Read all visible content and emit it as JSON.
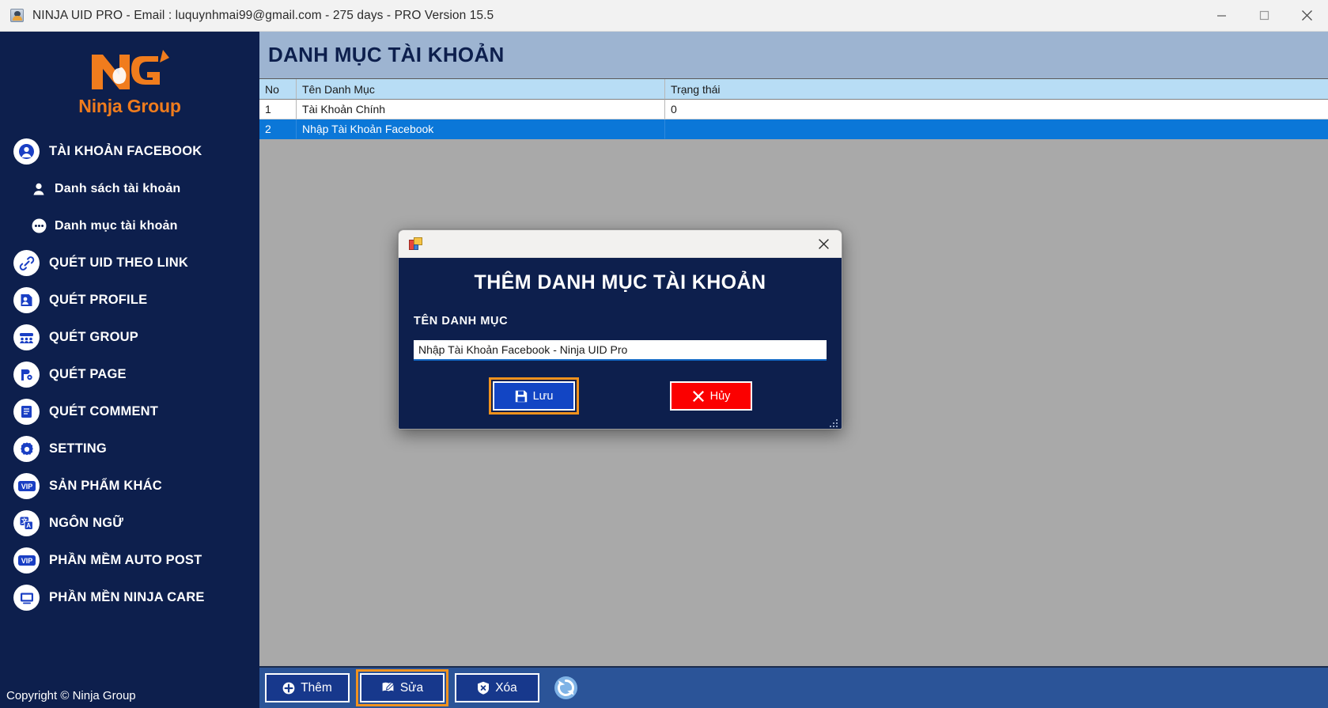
{
  "window": {
    "title": "NINJA UID PRO - Email : luquynhmai99@gmail.com - 275 days -  PRO Version 15.5",
    "app_icon": "ninja-app-icon",
    "controls": {
      "minimize": "minimize-icon",
      "maximize": "maximize-icon",
      "close": "close-icon"
    }
  },
  "sidebar": {
    "logo": {
      "mark": "ng-logo-icon",
      "text": "Ninja Group"
    },
    "items": [
      {
        "label": "TÀI KHOẢN FACEBOOK",
        "icon": "user-circle-icon",
        "sub": false
      },
      {
        "label": "Danh sách tài khoản",
        "icon": "person-icon",
        "sub": true
      },
      {
        "label": "Danh mục tài khoản",
        "icon": "dots-icon",
        "sub": true
      },
      {
        "label": "QUÉT UID THEO LINK",
        "icon": "link-icon",
        "sub": false
      },
      {
        "label": "QUÉT PROFILE",
        "icon": "profile-card-icon",
        "sub": false
      },
      {
        "label": "QUÉT GROUP",
        "icon": "group-icon",
        "sub": false
      },
      {
        "label": "QUÉT PAGE",
        "icon": "page-flag-icon",
        "sub": false
      },
      {
        "label": "QUÉT COMMENT",
        "icon": "document-icon",
        "sub": false
      },
      {
        "label": "SETTING",
        "icon": "gear-icon",
        "sub": false
      },
      {
        "label": "SẢN PHẨM KHÁC",
        "icon": "vip-icon",
        "sub": false
      },
      {
        "label": "NGÔN NGỮ",
        "icon": "translate-icon",
        "sub": false
      },
      {
        "label": "PHẦN MỀM AUTO POST",
        "icon": "vip-icon",
        "sub": false
      },
      {
        "label": "PHẦN MỀN NINJA CARE",
        "icon": "monitor-icon",
        "sub": false
      }
    ],
    "copyright": "Copyright © Ninja Group"
  },
  "main": {
    "page_title": "DANH MỤC TÀI KHOẢN",
    "table": {
      "columns": [
        "No",
        "Tên Danh Mục",
        "Trạng thái"
      ],
      "rows": [
        {
          "no": "1",
          "name": "Tài Khoản Chính",
          "status": "0",
          "selected": false
        },
        {
          "no": "2",
          "name": "Nhập Tài Khoản Facebook",
          "status": "",
          "selected": true
        }
      ]
    }
  },
  "toolbar": {
    "add_label": "Thêm",
    "edit_label": "Sửa",
    "delete_label": "Xóa",
    "add_icon": "plus-circle-icon",
    "edit_icon": "edit-pencil-icon",
    "delete_icon": "shield-delete-icon",
    "refresh_icon": "refresh-icon"
  },
  "modal": {
    "app_icon": "winform-icon",
    "close_icon": "close-icon",
    "title": "THÊM DANH MỤC TÀI KHOẢN",
    "field_label": "TÊN DANH MỤC",
    "field_value": "Nhập Tài Khoản Facebook - Ninja UID Pro",
    "field_placeholder": "",
    "save_label": "Lưu",
    "cancel_label": "Hủy",
    "save_icon": "save-floppy-icon",
    "cancel_icon": "cancel-x-icon"
  },
  "colors": {
    "sidebar_bg": "#0d1f4d",
    "accent_orange": "#f07c1d",
    "focus_orange": "#f0921e",
    "selection_blue": "#0b77d8",
    "toolbar_blue": "#2b5498",
    "danger_red": "#fb0000",
    "page_head_blue": "#9db4d1"
  }
}
